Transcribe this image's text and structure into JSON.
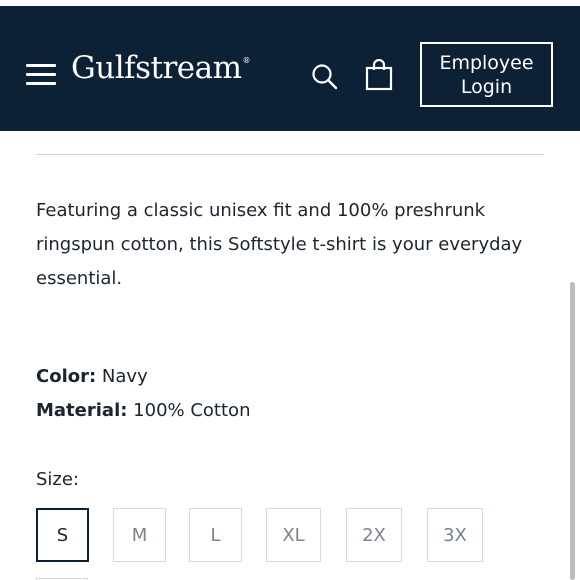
{
  "header": {
    "brand": "Gulfstream",
    "brand_mark": "®",
    "employee_login_label": "Employee\nLogin",
    "icons": {
      "menu": "hamburger-menu-icon",
      "search": "search-icon",
      "bag": "shopping-bag-icon"
    },
    "colors": {
      "background": "#0c2135",
      "foreground": "#ffffff"
    }
  },
  "product": {
    "description": "Featuring a classic unisex fit and 100% preshrunk ringspun cotton, this Softstyle t-shirt is your everyday essential.",
    "color_label": "Color:",
    "color_value": "Navy",
    "material_label": "Material:",
    "material_value": "100% Cotton",
    "size_label": "Size:",
    "sizes": [
      {
        "label": "S",
        "selected": true
      },
      {
        "label": "M",
        "selected": false
      },
      {
        "label": "L",
        "selected": false
      },
      {
        "label": "XL",
        "selected": false
      },
      {
        "label": "2X",
        "selected": false
      },
      {
        "label": "3X",
        "selected": false
      }
    ]
  }
}
